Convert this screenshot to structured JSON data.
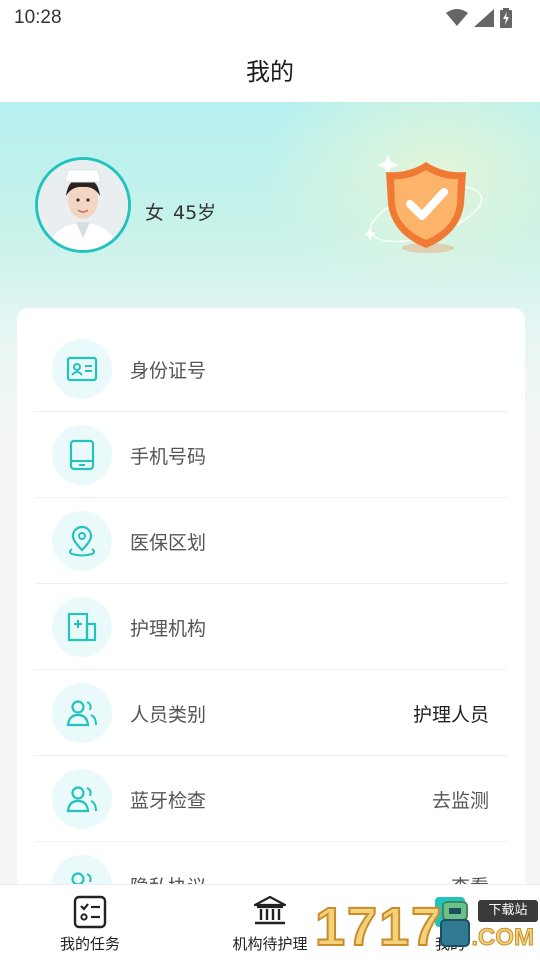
{
  "status_bar": {
    "time": "10:28",
    "icons": [
      "wifi-icon",
      "signal-icon",
      "battery-icon"
    ]
  },
  "nav": {
    "title": "我的"
  },
  "profile": {
    "gender": "女",
    "age": "45岁"
  },
  "menu": {
    "items": [
      {
        "icon": "id-card-icon",
        "label": "身份证号",
        "value": ""
      },
      {
        "icon": "tablet-icon",
        "label": "手机号码",
        "value": ""
      },
      {
        "icon": "location-pin-icon",
        "label": "医保区划",
        "value": ""
      },
      {
        "icon": "hospital-building-icon",
        "label": "护理机构",
        "value": ""
      },
      {
        "icon": "people-icon",
        "label": "人员类别",
        "value": "护理人员"
      },
      {
        "icon": "people-icon",
        "label": "蓝牙检查",
        "value": "去监测"
      },
      {
        "icon": "people-icon",
        "label": "隐私协议",
        "value": "查看"
      }
    ]
  },
  "tabs": [
    {
      "icon": "task-list-icon",
      "label": "我的任务"
    },
    {
      "icon": "institution-icon",
      "label": "机构待护理"
    },
    {
      "icon": "profile-icon",
      "label": "我的"
    }
  ],
  "watermark": {
    "digits": "1717",
    "box_text": "下载站",
    "com": ".COM"
  },
  "colors": {
    "accent": "#22c3bd",
    "icon_bg": "#eafafa",
    "shield_orange": "#f58a3a"
  }
}
